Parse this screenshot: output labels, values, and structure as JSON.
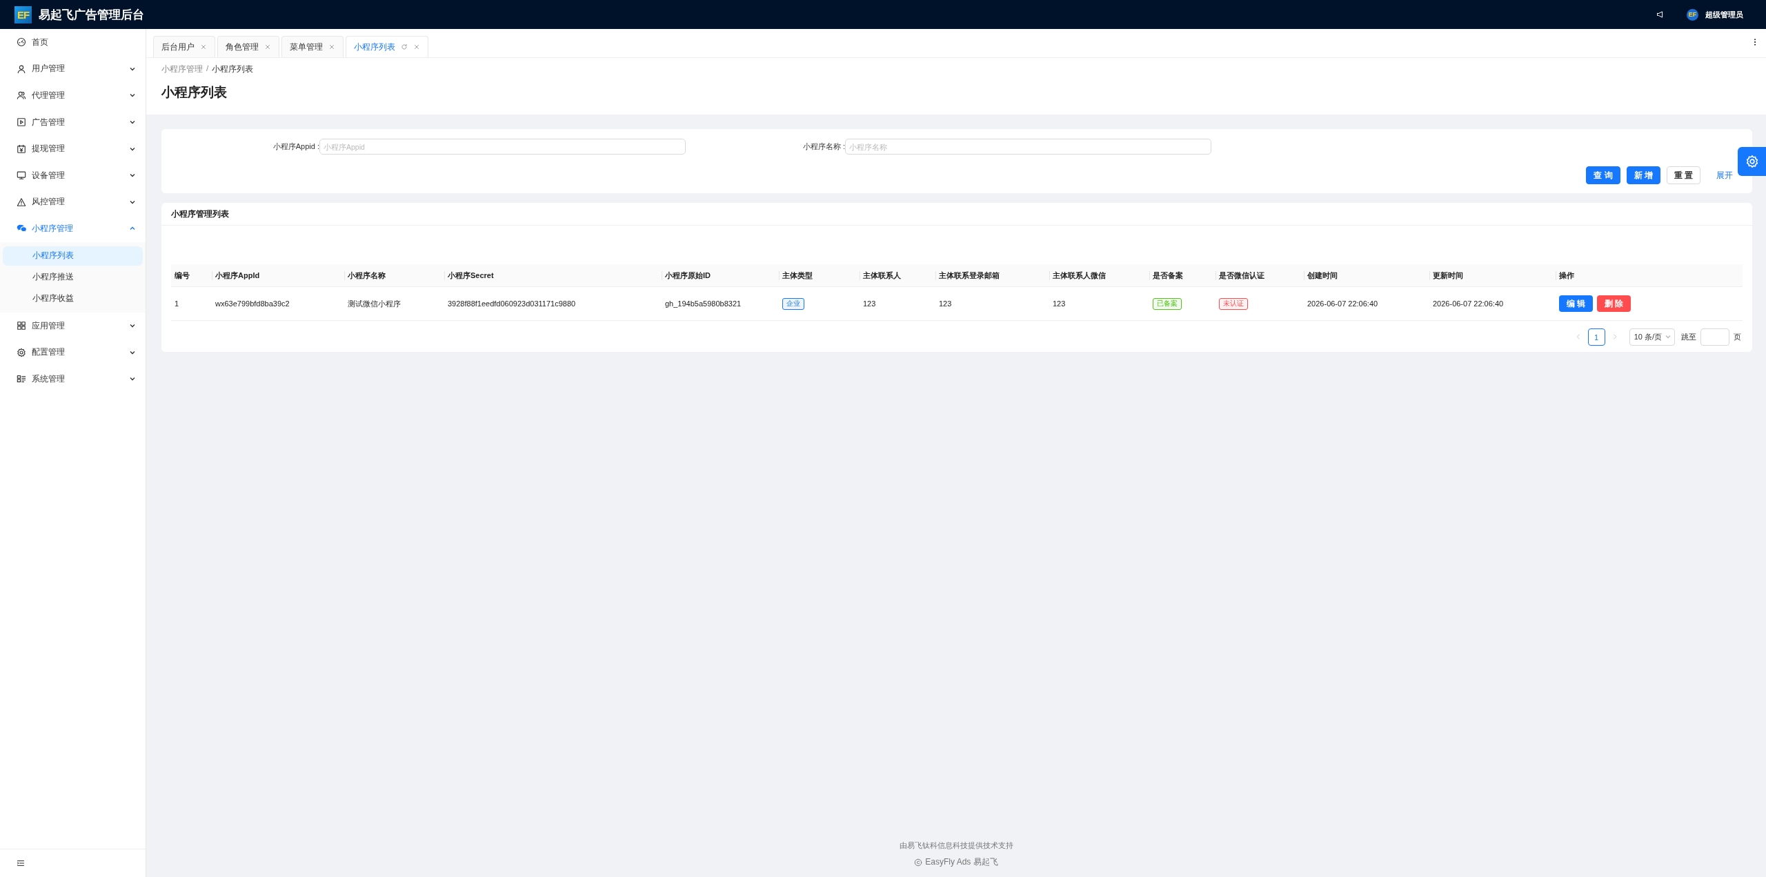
{
  "header": {
    "logo_text": "EF",
    "title": "易起飞广告管理后台",
    "avatar_text": "EF",
    "user_name": "超级管理员"
  },
  "sidebar": {
    "items": [
      {
        "label": "首页",
        "selected": false
      },
      {
        "label": "用户管理",
        "selected": false,
        "expanded": false
      },
      {
        "label": "代理管理",
        "selected": false,
        "expanded": false
      },
      {
        "label": "广告管理",
        "selected": false,
        "expanded": false
      },
      {
        "label": "提现管理",
        "selected": false,
        "expanded": false
      },
      {
        "label": "设备管理",
        "selected": false,
        "expanded": false
      },
      {
        "label": "风控管理",
        "selected": false,
        "expanded": false
      },
      {
        "label": "小程序管理",
        "selected": true,
        "expanded": true,
        "children": [
          {
            "label": "小程序列表",
            "selected": true
          },
          {
            "label": "小程序推送",
            "selected": false
          },
          {
            "label": "小程序收益",
            "selected": false
          }
        ]
      },
      {
        "label": "应用管理",
        "selected": false,
        "expanded": false
      },
      {
        "label": "配置管理",
        "selected": false,
        "expanded": false
      },
      {
        "label": "系统管理",
        "selected": false,
        "expanded": false
      }
    ]
  },
  "tabs": [
    {
      "label": "后台用户",
      "selected": false
    },
    {
      "label": "角色管理",
      "selected": false
    },
    {
      "label": "菜单管理",
      "selected": false
    },
    {
      "label": "小程序列表",
      "selected": true
    }
  ],
  "breadcrumb": [
    "小程序管理",
    "小程序列表"
  ],
  "breadcrumb_separator": "/",
  "page_title": "小程序列表",
  "search": {
    "fields": [
      {
        "label": "小程序Appid :",
        "placeholder": "小程序Appid"
      },
      {
        "label": "小程序名称 :",
        "placeholder": "小程序名称"
      }
    ],
    "buttons": [
      {
        "label": "查 询",
        "kind": "primary"
      },
      {
        "label": "新 增",
        "kind": "primary"
      },
      {
        "label": "重 置",
        "kind": "default"
      }
    ],
    "expand_link": "展开"
  },
  "table": {
    "title": "小程序管理列表",
    "columns": [
      "编号",
      "小程序AppId",
      "小程序名称",
      "小程序Secret",
      "小程序原始ID",
      "主体类型",
      "主体联系人",
      "主体联系登录邮箱",
      "主体联系人微信",
      "是否备案",
      "是否微信认证",
      "创建时间",
      "更新时间",
      "操作"
    ],
    "rows": [
      {
        "cells": [
          {
            "kind": "text",
            "text": "1"
          },
          {
            "kind": "text",
            "text": "wx63e799bfd8ba39c2"
          },
          {
            "kind": "text",
            "text": "测试微信小程序"
          },
          {
            "kind": "text",
            "text": "3928f88f1eedfd060923d031171c9880"
          },
          {
            "kind": "text",
            "text": "gh_194b5a5980b8321"
          },
          {
            "kind": "tag",
            "text": "企业",
            "color": "#1677ff"
          },
          {
            "kind": "text",
            "text": "123"
          },
          {
            "kind": "text",
            "text": "123"
          },
          {
            "kind": "text",
            "text": "123"
          },
          {
            "kind": "tag",
            "text": "已备案",
            "color": "#52c41a"
          },
          {
            "kind": "tag",
            "text": "未认证",
            "color": "#ff4d4f"
          },
          {
            "kind": "text",
            "text": "2026-06-07 22:06:40"
          },
          {
            "kind": "text",
            "text": "2026-06-07 22:06:40"
          }
        ],
        "actions": [
          {
            "label": "编 辑",
            "kind": "primary"
          },
          {
            "label": "删 除",
            "kind": "danger"
          }
        ]
      }
    ]
  },
  "pagination": {
    "pages": [
      {
        "label": "1",
        "selected": true
      }
    ],
    "page_size": "10 条/页",
    "jump_label": "跳至",
    "page_suffix": "页"
  },
  "footer": {
    "support": "由易飞钛科信息科技提供技术支持",
    "copyright": "EasyFly Ads 易起飞"
  }
}
